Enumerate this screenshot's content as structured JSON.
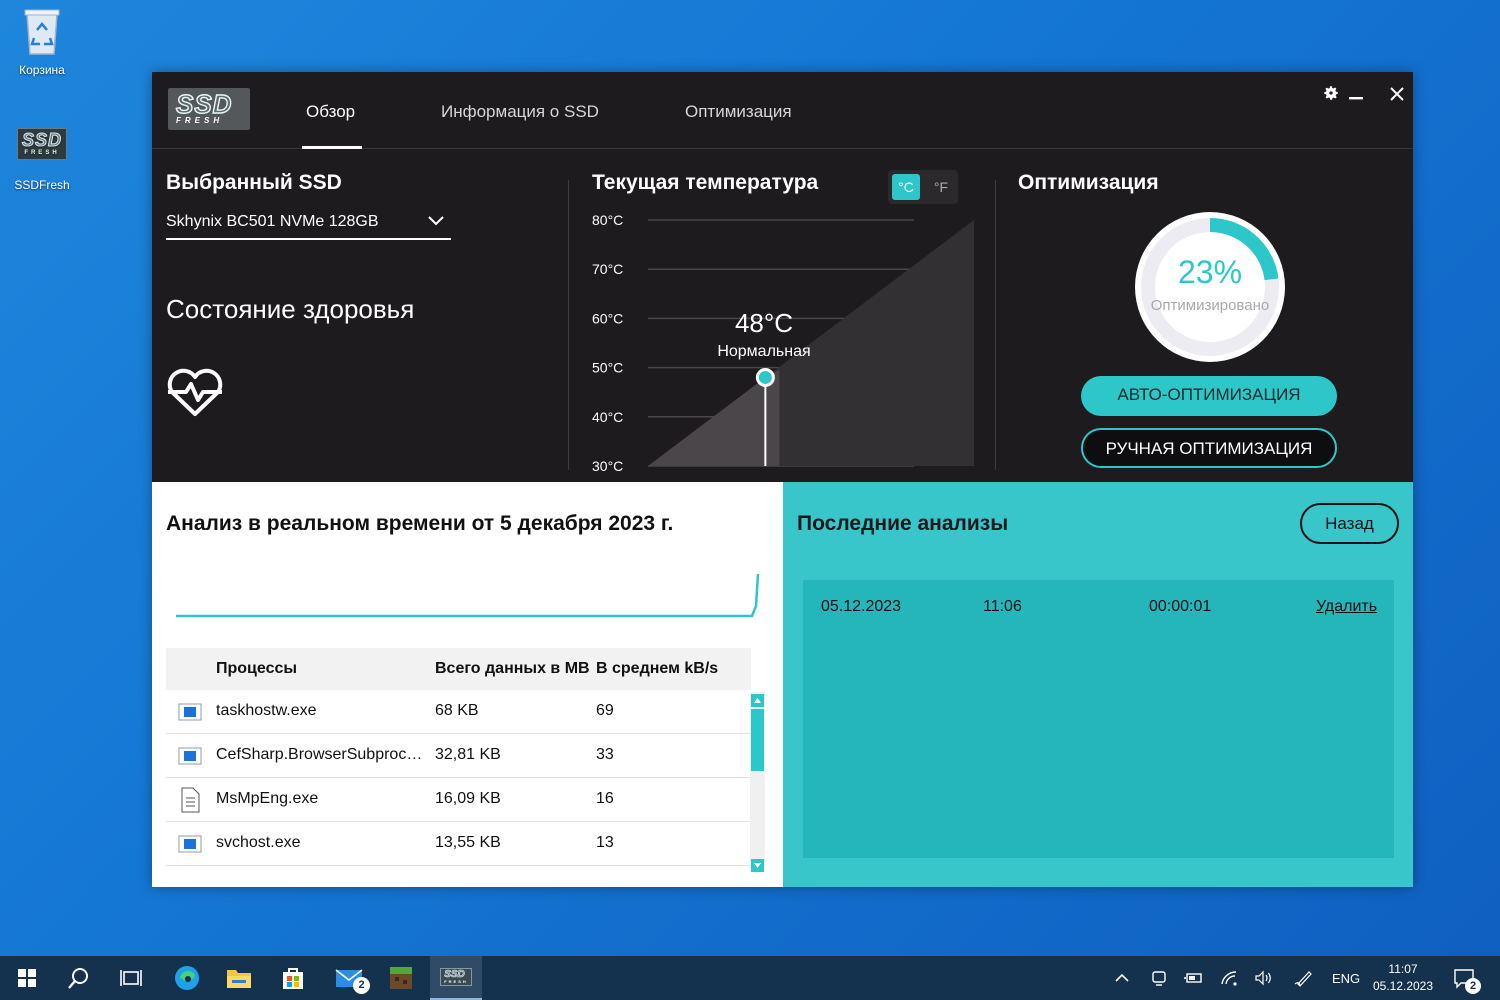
{
  "desktop": {
    "recycle_bin_label": "Корзина",
    "ssdfresh_label": "SSDFresh",
    "logo_top": "SSD",
    "logo_bottom": "FRESH"
  },
  "app": {
    "logo_top": "SSD",
    "logo_bottom": "FRESH",
    "tabs": [
      {
        "label": "Обзор",
        "active": true
      },
      {
        "label": "Информация о SSD",
        "active": false
      },
      {
        "label": "Оптимизация",
        "active": false
      }
    ],
    "controls": {
      "settings_icon": "gear-icon",
      "minimize_icon": "minimize-icon",
      "close_icon": "close-icon"
    }
  },
  "ssd": {
    "title": "Выбранный SSD",
    "selected": "Skhynix BC501 NVMe 128GB",
    "health_title": "Состояние здоровья",
    "health_icon": "heartbeat-icon"
  },
  "temperature": {
    "title": "Текущая температура",
    "unit_c": "°C",
    "unit_f": "°F",
    "value_label": "48°C",
    "status": "Нормальная",
    "current": 48,
    "ticks": [
      "80°C",
      "70°C",
      "60°C",
      "50°C",
      "40°C",
      "30°C"
    ],
    "range": [
      30,
      80
    ]
  },
  "optimization": {
    "title": "Оптимизация",
    "percent_label": "23%",
    "percent_value": 23,
    "status": "Оптимизировано",
    "auto_button": "АВТО-ОПТИМИЗАЦИЯ",
    "manual_button": "РУЧНАЯ ОПТИМИЗАЦИЯ"
  },
  "analysis": {
    "title": "Анализ в реальном времени от 5 декабря 2023 г.",
    "columns": [
      "Процессы",
      "Всего данных в MB",
      "В среднем kB/s"
    ],
    "rows": [
      {
        "icon": "window-app-icon",
        "name": "taskhostw.exe",
        "total": "68 KB",
        "avg": "69"
      },
      {
        "icon": "window-app-icon",
        "name": "CefSharp.BrowserSubproc…",
        "total": "32,81 KB",
        "avg": "33"
      },
      {
        "icon": "document-icon",
        "name": "MsMpEng.exe",
        "total": "16,09 KB",
        "avg": "16"
      },
      {
        "icon": "window-app-icon",
        "name": "svchost.exe",
        "total": "13,55 KB",
        "avg": "13"
      }
    ]
  },
  "recent": {
    "title": "Последние анализы",
    "back_button": "Назад",
    "entries": [
      {
        "date": "05.12.2023",
        "time": "11:06",
        "duration": "00:00:01",
        "action": "Удалить"
      }
    ]
  },
  "taskbar": {
    "language": "ENG",
    "time": "11:07",
    "date": "05.12.2023",
    "mail_badge": "2",
    "notif_badge": "2",
    "logo_top": "SSD",
    "logo_bottom": "FRESH"
  },
  "colors": {
    "accent": "#2ec7c9",
    "window_bg": "#1e1b1f",
    "panel_teal": "#38c6cb"
  }
}
